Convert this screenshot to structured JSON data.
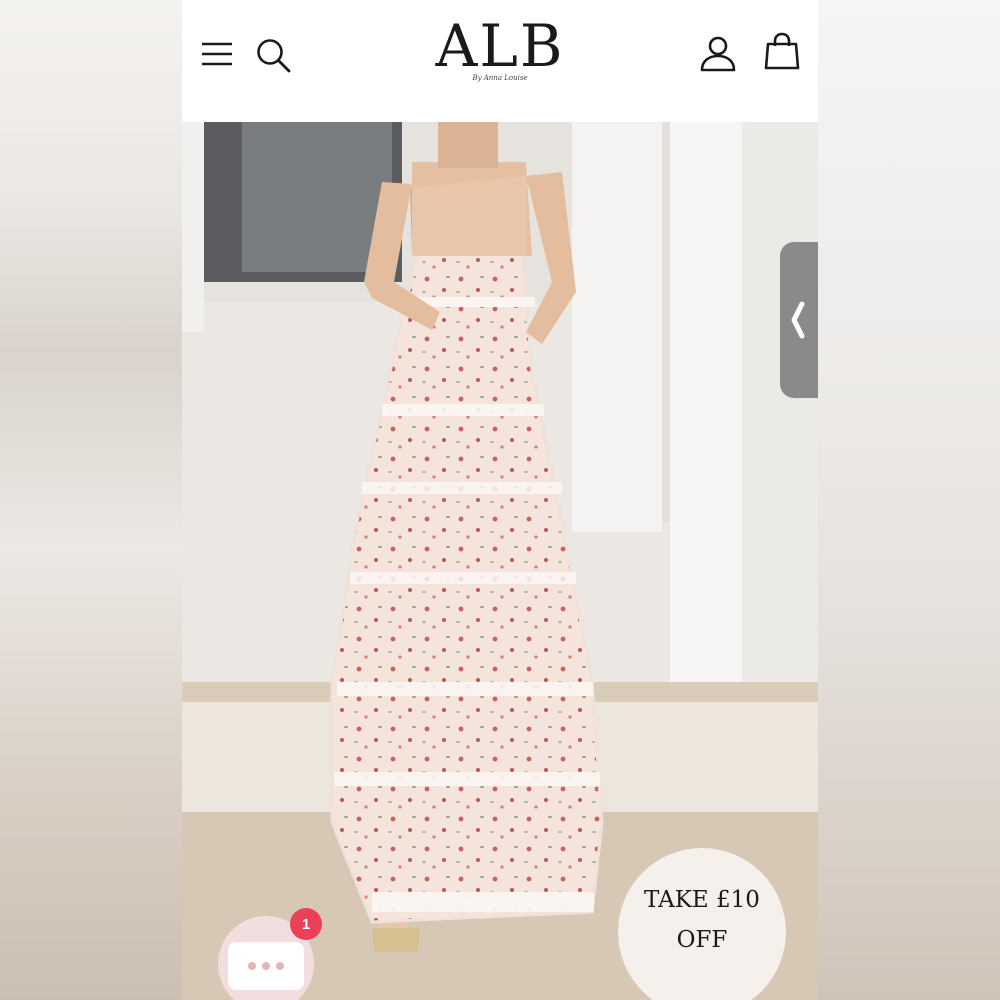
{
  "header": {
    "logo": "ALB",
    "logo_sub": "By Anna Louise",
    "icons": [
      "menu-icon",
      "search-icon",
      "account-icon",
      "bag-icon"
    ]
  },
  "drawer": {
    "icon": "chevron-left-icon"
  },
  "promo": {
    "line1": "TAKE £10",
    "line2": "OFF"
  },
  "chat": {
    "badge": "1",
    "icon": "chat-icon"
  },
  "colors": {
    "badge": "#ee3f5a",
    "drawer_tab": "#8a8a8a",
    "promo_bg": "#f6f0ec",
    "chat_bg": "#f2dede"
  }
}
